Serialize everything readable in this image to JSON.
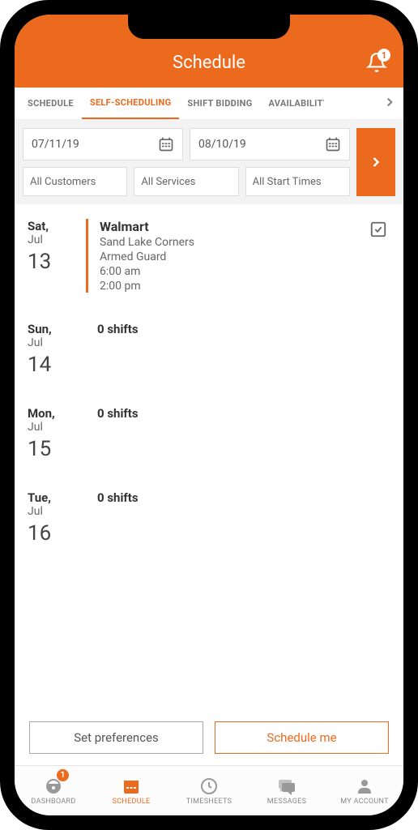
{
  "header": {
    "title": "Schedule",
    "bell_badge": "1"
  },
  "tabs": {
    "items": [
      "SCHEDULE",
      "SELF-SCHEDULING",
      "SHIFT BIDDING",
      "AVAILABILITY"
    ],
    "active_index": 1
  },
  "filters": {
    "date_from": "07/11/19",
    "date_to": "08/10/19",
    "customers": "All Customers",
    "services": "All Services",
    "start_times": "All Start Times"
  },
  "days": [
    {
      "dow": "Sat,",
      "mon": "Jul",
      "num": "13",
      "has_shift": true,
      "shift": {
        "title": "Walmart",
        "location": "Sand Lake Corners",
        "role": "Armed Guard",
        "start": "6:00 am",
        "end": "2:00 pm"
      }
    },
    {
      "dow": "Sun,",
      "mon": "Jul",
      "num": "14",
      "has_shift": false,
      "empty_text": "0 shifts"
    },
    {
      "dow": "Mon,",
      "mon": "Jul",
      "num": "15",
      "has_shift": false,
      "empty_text": "0 shifts"
    },
    {
      "dow": "Tue,",
      "mon": "Jul",
      "num": "16",
      "has_shift": false,
      "empty_text": "0 shifts"
    }
  ],
  "actions": {
    "prefs": "Set preferences",
    "schedule": "Schedule me"
  },
  "nav": {
    "items": [
      {
        "label": "DASHBOARD",
        "icon": "dashboard",
        "badge": "1"
      },
      {
        "label": "SCHEDULE",
        "icon": "calendar"
      },
      {
        "label": "TIMESHEETS",
        "icon": "clock"
      },
      {
        "label": "MESSAGES",
        "icon": "chat"
      },
      {
        "label": "MY ACCOUNT",
        "icon": "user"
      }
    ],
    "active_index": 1
  }
}
